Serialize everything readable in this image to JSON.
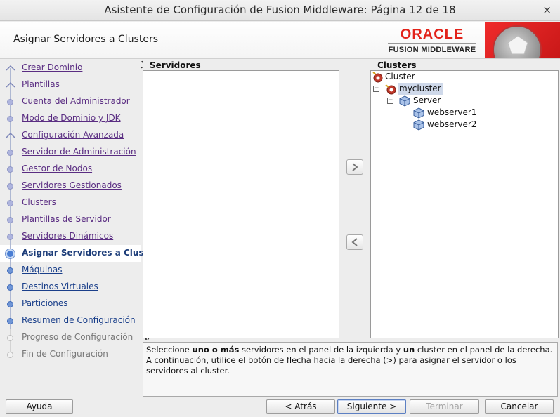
{
  "window": {
    "title": "Asistente de Configuración de Fusion Middleware: Página 12 de 18",
    "close_glyph": "×"
  },
  "header": {
    "page_title": "Asignar Servidores a Clusters",
    "logo": {
      "brand": "ORACLE",
      "sub": "FUSION MIDDLEWARE",
      "accent": "#e2231a"
    }
  },
  "steps": [
    {
      "label": "Crear Dominio",
      "state": "done"
    },
    {
      "label": "Plantillas",
      "state": "done"
    },
    {
      "label": "Cuenta del Administrador",
      "state": "done"
    },
    {
      "label": "Modo de Dominio y JDK",
      "state": "done"
    },
    {
      "label": "Configuración Avanzada",
      "state": "done"
    },
    {
      "label": "Servidor de Administración",
      "state": "done"
    },
    {
      "label": "Gestor de Nodos",
      "state": "done"
    },
    {
      "label": "Servidores Gestionados",
      "state": "done"
    },
    {
      "label": "Clusters",
      "state": "done"
    },
    {
      "label": "Plantillas de Servidor",
      "state": "done"
    },
    {
      "label": "Servidores Dinámicos",
      "state": "done"
    },
    {
      "label": "Asignar Servidores a Clust",
      "state": "active"
    },
    {
      "label": "Máquinas",
      "state": "next"
    },
    {
      "label": "Destinos Virtuales",
      "state": "next"
    },
    {
      "label": "Particiones",
      "state": "next"
    },
    {
      "label": "Resumen de Configuración",
      "state": "next"
    },
    {
      "label": "Progreso de Configuración",
      "state": "future"
    },
    {
      "label": "Fin de Configuración",
      "state": "future"
    }
  ],
  "servers_panel": {
    "heading": "Servidores"
  },
  "clusters_panel": {
    "heading": "Clusters",
    "root": "Cluster",
    "cluster": "mycluster",
    "group": "Server",
    "members": [
      "webserver1",
      "webserver2"
    ]
  },
  "arrows": {
    "right": "⋗",
    "left": "⋖"
  },
  "info": {
    "line1_a": "Seleccione ",
    "line1_b": "uno o más",
    "line1_c": " servidores en el panel de la izquierda y ",
    "line1_d": "un",
    "line1_e": " cluster en el panel de la derecha.",
    "line2": "A continuación, utilice el botón de flecha hacia la derecha (>) para asignar el servidor o los",
    "line3": "servidores al cluster."
  },
  "buttons": {
    "help": "Ayuda",
    "back": "< Atrás",
    "next": "Siguiente >",
    "finish": "Terminar",
    "cancel": "Cancelar"
  }
}
